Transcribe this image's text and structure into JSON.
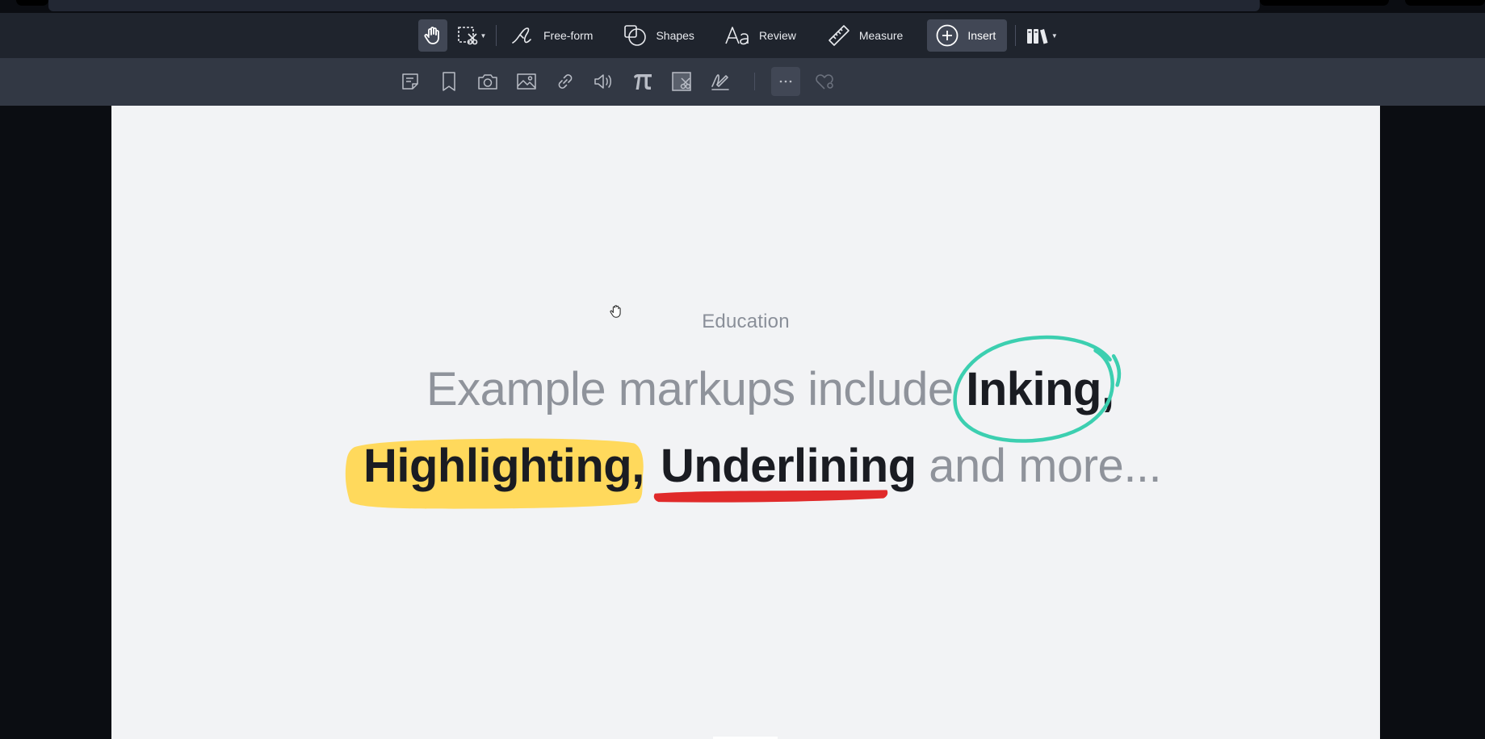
{
  "toolbar": {
    "tools": {
      "freeform_label": "Free-form",
      "shapes_label": "Shapes",
      "review_label": "Review",
      "measure_label": "Measure",
      "insert_label": "Insert"
    },
    "active_tool": "hand-tool",
    "colors": {
      "main_bg": "#1f242d",
      "sub_bg": "#323844",
      "active_bg": "#414755"
    }
  },
  "subtoolbar": {
    "icons": [
      "sticky-note-icon",
      "bookmark-icon",
      "camera-icon",
      "image-icon",
      "link-icon",
      "audio-icon",
      "pi-icon",
      "stamp-icon",
      "signature-icon",
      "more-icon",
      "favorites-icon"
    ]
  },
  "document": {
    "eyebrow": "Education",
    "line1_plain": "Example markups include ",
    "line1_inked": "Inking,",
    "line2_highlighted": "Highlighting,",
    "line2_underlined": "Underlining",
    "line2_plain": " and more...",
    "colors": {
      "highlight": "#ffd95c",
      "underline": "#e02a2a",
      "ink_circle": "#3ccfb0",
      "page_bg": "#f2f3f5"
    }
  }
}
